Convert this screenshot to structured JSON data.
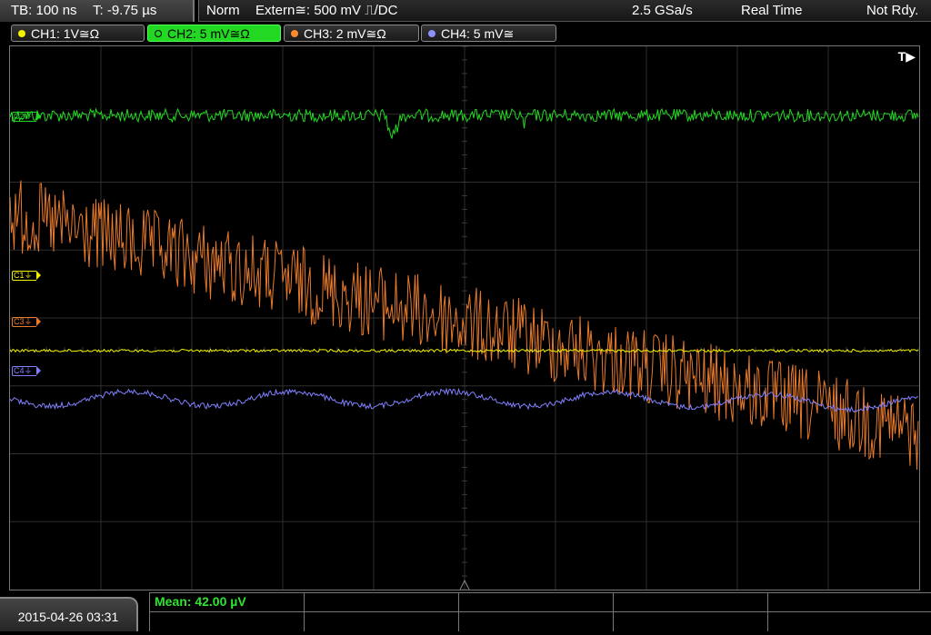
{
  "topbar": {
    "timebase": "TB: 100 ns",
    "trigger_pos": "T: -9.75 µs",
    "mode": "Norm",
    "trigger_source": "Extern≅: 500 mV ⎍/DC",
    "sample_rate": "2.5 GSa/s",
    "acq_mode": "Real Time",
    "status": "Not Rdy."
  },
  "channels": [
    {
      "label": "CH1: 1V≅Ω",
      "color": "#f2f200"
    },
    {
      "label": "CH2: 5 mV≅Ω",
      "color": "#22d822"
    },
    {
      "label": "CH3: 2 mV≅Ω",
      "color": "#ff8a2e"
    },
    {
      "label": "CH4: 5 mV≅",
      "color": "#8f8fff"
    }
  ],
  "screen": {
    "trigger_tag": "T▶",
    "markers": {
      "c2": "C2⏚",
      "c1": "C1⏚",
      "c3": "C3⏚",
      "c4": "C4⏚"
    }
  },
  "footer": {
    "datetime": "2015-04-26 03:31",
    "measurement": "Mean: 42.00 µV"
  },
  "colors": {
    "ch1": "#f2f200",
    "ch2": "#22d822",
    "ch3": "#e87a2a",
    "ch4": "#8080ff",
    "grid": "#2e2e2e"
  }
}
